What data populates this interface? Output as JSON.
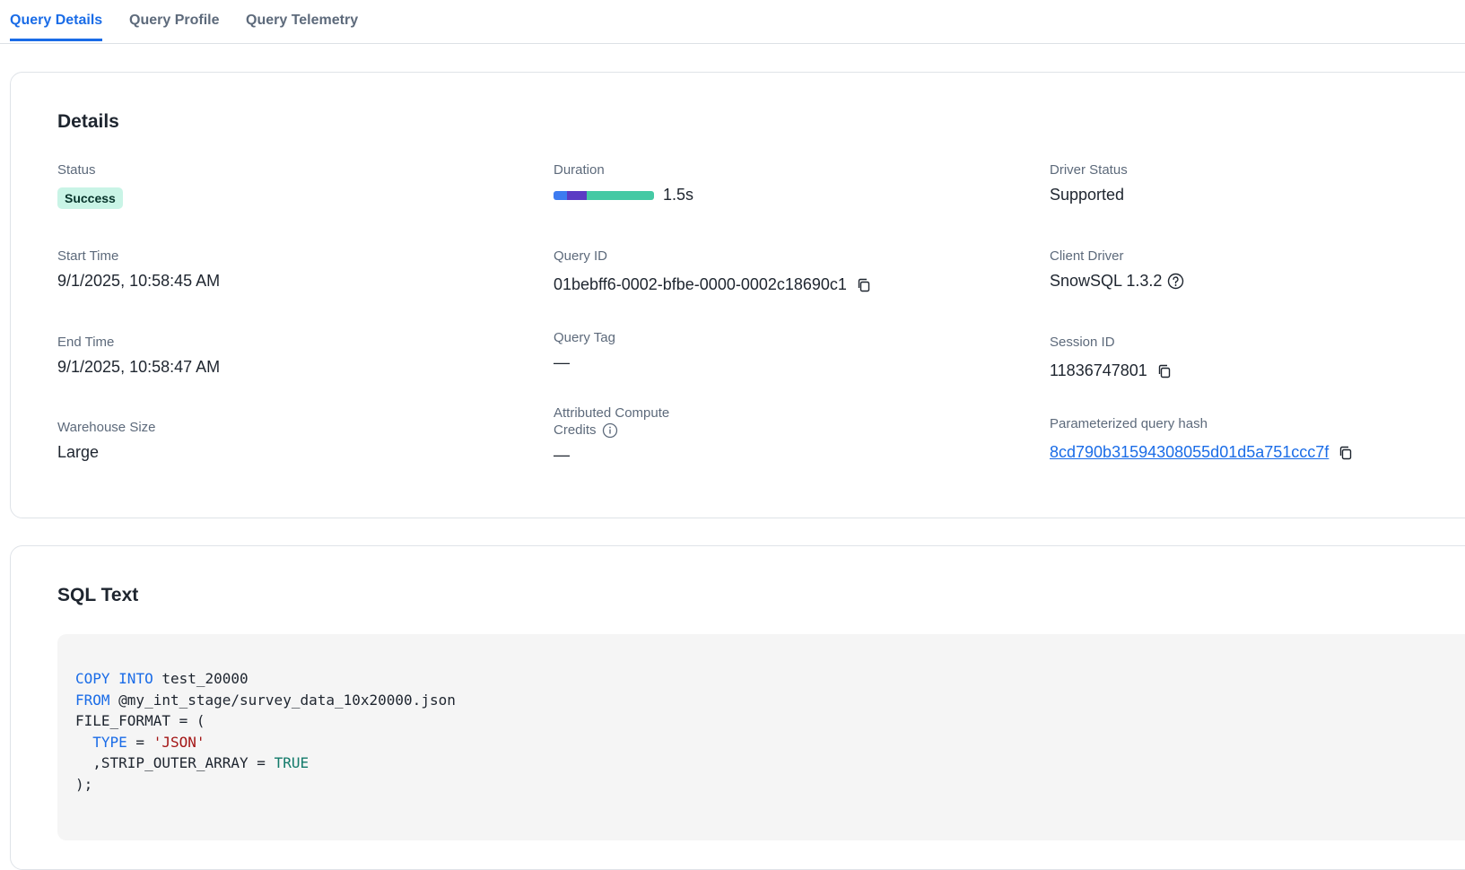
{
  "tabs": [
    {
      "label": "Query Details",
      "active": true
    },
    {
      "label": "Query Profile",
      "active": false
    },
    {
      "label": "Query Telemetry",
      "active": false
    }
  ],
  "details": {
    "title": "Details",
    "status_label": "Status",
    "status_value": "Success",
    "duration_label": "Duration",
    "duration_value": "1.5s",
    "duration_segments": [
      {
        "fraction": 0.13,
        "color": "#3d7bf0"
      },
      {
        "fraction": 0.2,
        "color": "#5b3cc4"
      },
      {
        "fraction": 0.67,
        "color": "#45c9a4"
      }
    ],
    "driver_status_label": "Driver Status",
    "driver_status_value": "Supported",
    "start_time_label": "Start Time",
    "start_time_value": "9/1/2025, 10:58:45 AM",
    "query_id_label": "Query ID",
    "query_id_value": "01bebff6-0002-bfbe-0000-0002c18690c1",
    "client_driver_label": "Client Driver",
    "client_driver_value": "SnowSQL 1.3.2",
    "end_time_label": "End Time",
    "end_time_value": "9/1/2025, 10:58:47 AM",
    "query_tag_label": "Query Tag",
    "query_tag_value": "—",
    "session_id_label": "Session ID",
    "session_id_value": "11836747801",
    "warehouse_size_label": "Warehouse Size",
    "warehouse_size_value": "Large",
    "credits_label_line1": "Attributed Compute",
    "credits_label_line2": "Credits",
    "credits_value": "—",
    "hash_label": "Parameterized query hash",
    "hash_value": "8cd790b31594308055d01d5a751ccc7f"
  },
  "sql": {
    "title": "SQL Text",
    "lines": [
      {
        "tokens": [
          {
            "t": "COPY",
            "c": "kw"
          },
          {
            "t": " "
          },
          {
            "t": "INTO",
            "c": "kw"
          },
          {
            "t": " test_20000"
          }
        ]
      },
      {
        "tokens": [
          {
            "t": "FROM",
            "c": "kw"
          },
          {
            "t": " @my_int_stage/survey_data_10x20000.json"
          }
        ]
      },
      {
        "tokens": [
          {
            "t": "FILE_FORMAT = ("
          }
        ]
      },
      {
        "tokens": [
          {
            "t": "  "
          },
          {
            "t": "TYPE",
            "c": "kw"
          },
          {
            "t": " = "
          },
          {
            "t": "'JSON'",
            "c": "str"
          }
        ]
      },
      {
        "tokens": [
          {
            "t": "  ,STRIP_OUTER_ARRAY = "
          },
          {
            "t": "TRUE",
            "c": "bool"
          }
        ]
      },
      {
        "tokens": [
          {
            "t": ");"
          }
        ]
      }
    ]
  },
  "icons": {
    "copy": "copy-icon",
    "help": "question-circle-icon",
    "info": "info-circle-icon"
  }
}
